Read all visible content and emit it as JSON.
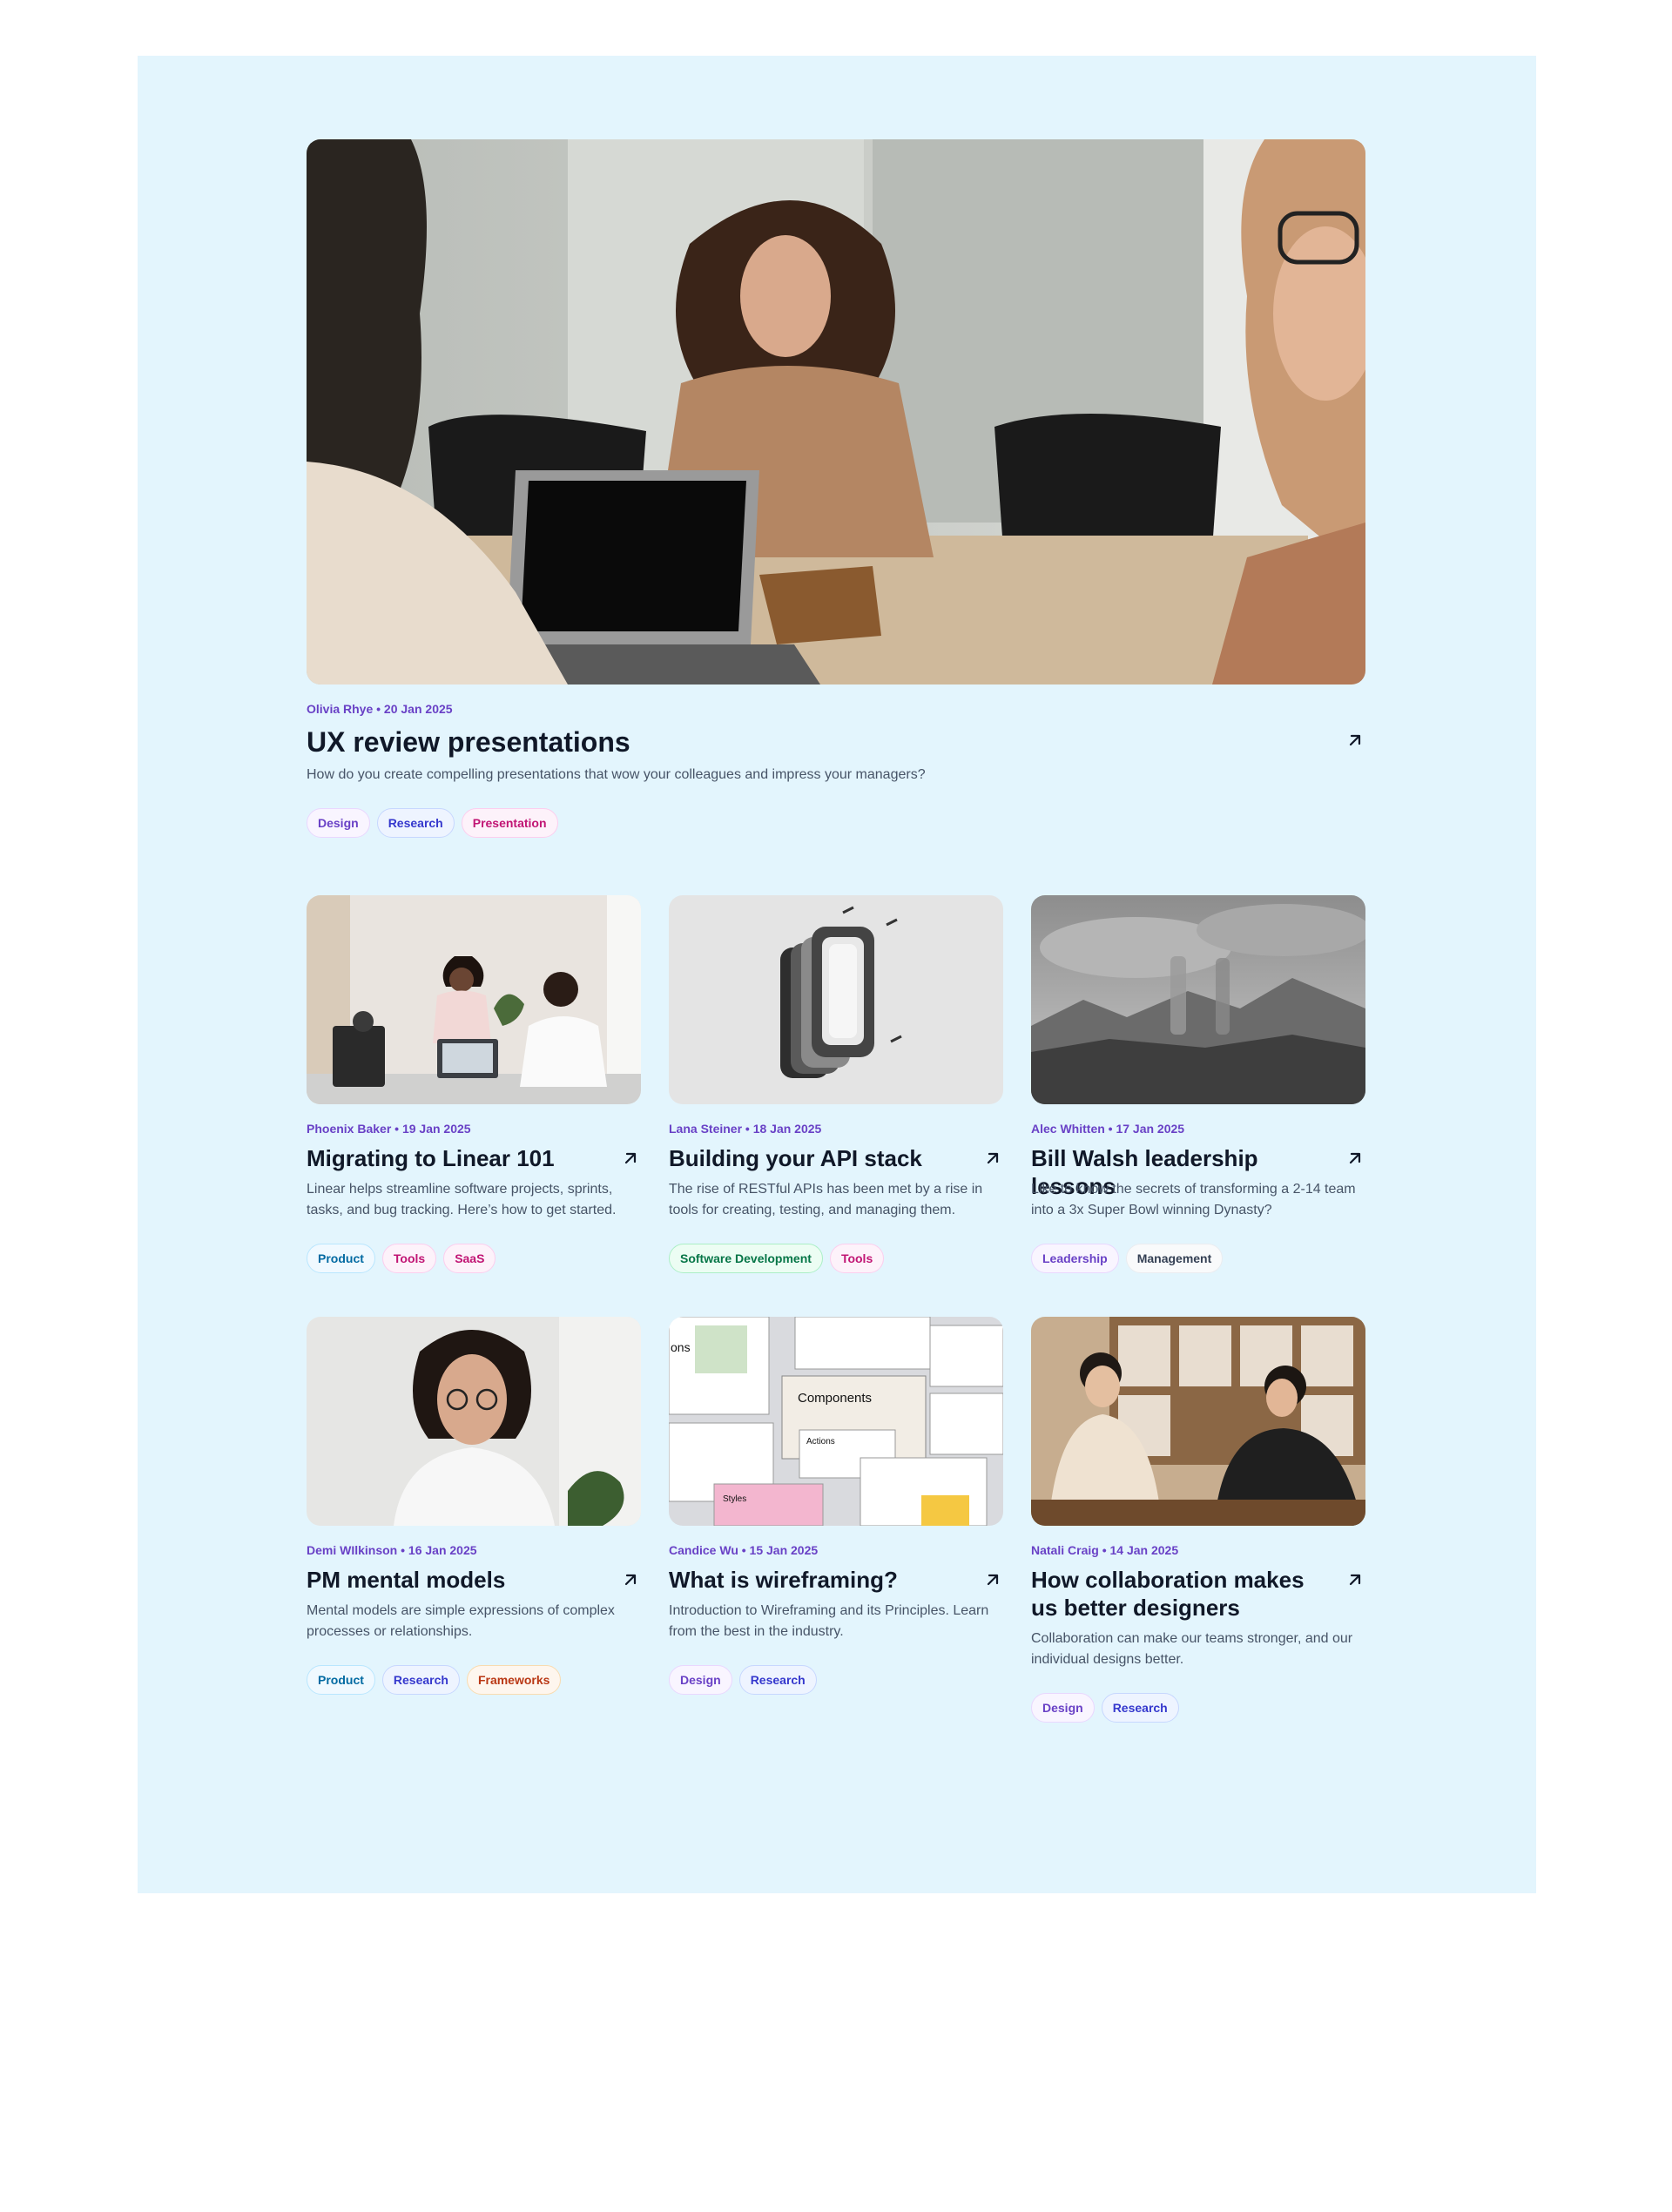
{
  "featured": {
    "image": "featured-photo",
    "meta": "Olivia Rhye • 20 Jan 2025",
    "title": "UX review presentations",
    "desc": "How do you create compelling presentations that wow your colleagues and impress your managers?",
    "tags": [
      "Design",
      "Research",
      "Presentation"
    ]
  },
  "posts": [
    {
      "meta": "Phoenix Baker • 19 Jan 2025",
      "title": "Migrating to Linear 101",
      "desc": "Linear helps streamline software projects, sprints, tasks, and bug tracking. Here’s how to get started.",
      "tags": [
        "Product",
        "Tools",
        "SaaS"
      ]
    },
    {
      "meta": "Lana Steiner • 18 Jan 2025",
      "title": "Building your API stack",
      "desc": "The rise of RESTful APIs has been met by a rise in tools for creating, testing, and managing them.",
      "tags": [
        "Software Development",
        "Tools"
      ]
    },
    {
      "meta": "Alec Whitten • 17 Jan 2025",
      "title": "Bill Walsh leadership lessons",
      "desc": "Like to know the secrets of transforming a 2-14 team into a 3x Super Bowl winning Dynasty?",
      "tags": [
        "Leadership",
        "Management"
      ]
    },
    {
      "meta": "Demi WIlkinson • 16 Jan 2025",
      "title": "PM mental models",
      "desc": "Mental models are simple expressions of complex processes or relationships.",
      "tags": [
        "Product",
        "Research",
        "Frameworks"
      ]
    },
    {
      "meta": "Candice Wu • 15 Jan 2025",
      "title": "What is wireframing?",
      "desc": "Introduction to Wireframing and its Principles. Learn from the best in the industry.",
      "tags": [
        "Design",
        "Research"
      ],
      "image_text": {
        "word_a": "ons",
        "word_b": "Components",
        "word_c": "Actions",
        "word_d": "Styles"
      }
    },
    {
      "meta": "Natali Craig • 14 Jan 2025",
      "title": "How collaboration makes us better designers",
      "desc": "Collaboration can make our teams stronger, and our individual designs better.",
      "tags": [
        "Design",
        "Research"
      ]
    }
  ],
  "colors": {
    "panel": "#e3f5fd",
    "meta": "#6941c6",
    "title": "#101828",
    "desc": "#475467"
  },
  "icons": {
    "arrow": "arrow-up-right-icon"
  }
}
